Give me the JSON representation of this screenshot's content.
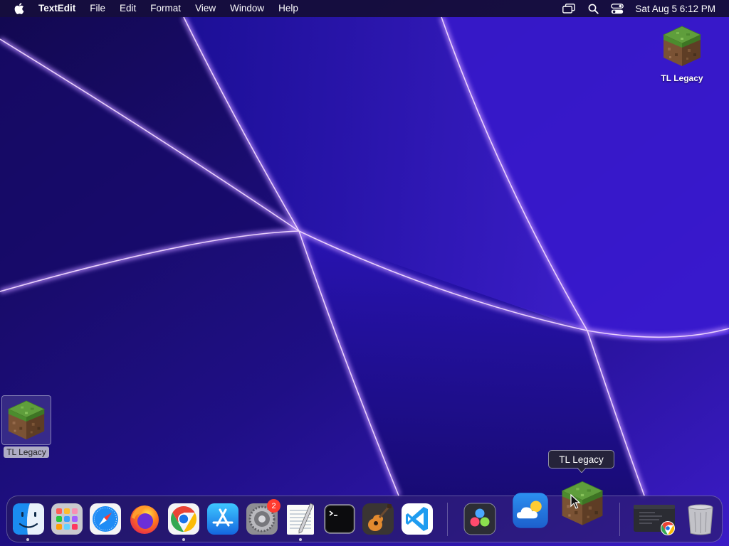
{
  "menubar": {
    "app_name": "TextEdit",
    "items": [
      "File",
      "Edit",
      "Format",
      "View",
      "Window",
      "Help"
    ],
    "clock": "Sat Aug 5  6:12 PM",
    "status_icons": [
      "screen-mirroring-icon",
      "spotlight-search-icon",
      "control-center-icon"
    ]
  },
  "desktop": {
    "icons": [
      {
        "label": "TL Legacy",
        "icon": "minecraft-grass-block-icon",
        "selected": false
      },
      {
        "label": "TL Legacy",
        "icon": "minecraft-grass-block-icon",
        "selected": true
      }
    ]
  },
  "tooltip": {
    "text": "TL Legacy"
  },
  "dock": {
    "items": [
      {
        "name": "Finder",
        "icon": "finder-icon",
        "running": true
      },
      {
        "name": "Launchpad",
        "icon": "launchpad-icon",
        "running": false
      },
      {
        "name": "Safari",
        "icon": "safari-icon",
        "running": false
      },
      {
        "name": "Firefox",
        "icon": "firefox-icon",
        "running": false
      },
      {
        "name": "Google Chrome",
        "icon": "chrome-icon",
        "running": true
      },
      {
        "name": "App Store",
        "icon": "app-store-icon",
        "running": false
      },
      {
        "name": "System Settings",
        "icon": "system-settings-icon",
        "running": false,
        "badge": "2"
      },
      {
        "name": "TextEdit",
        "icon": "textedit-icon",
        "running": true
      },
      {
        "name": "Terminal",
        "icon": "terminal-icon",
        "running": false
      },
      {
        "name": "GarageBand",
        "icon": "garageband-icon",
        "running": false
      },
      {
        "name": "Visual Studio Code",
        "icon": "vscode-icon",
        "running": false
      },
      {
        "name": "DaVinci Resolve",
        "icon": "davinci-resolve-icon",
        "running": false
      },
      {
        "name": "Weather",
        "icon": "weather-icon",
        "running": false
      },
      {
        "name": "TL Legacy",
        "icon": "minecraft-grass-block-icon",
        "running": false
      },
      {
        "name": "Chrome window",
        "icon": "chrome-window-thumbnail-icon",
        "running": false
      },
      {
        "name": "Trash",
        "icon": "trash-icon",
        "running": false
      }
    ]
  },
  "colors": {
    "wallpaper_deep": "#140a55",
    "wallpaper_mid": "#3a1cc2",
    "wallpaper_glow": "#c79bff",
    "badge": "#ff3b30"
  }
}
